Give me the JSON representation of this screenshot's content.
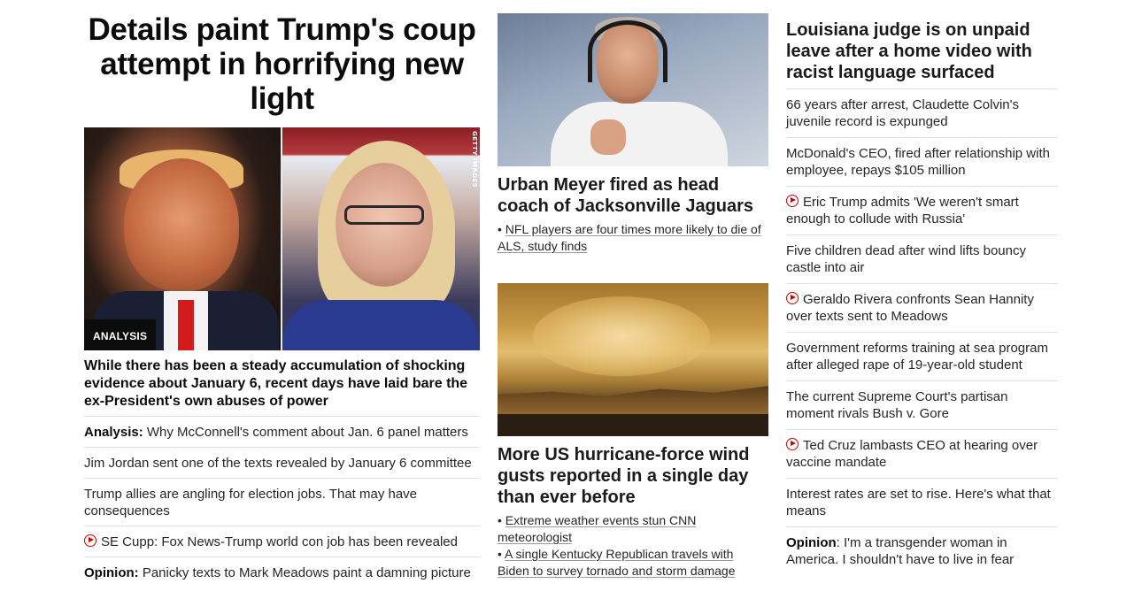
{
  "left": {
    "headline": "Details paint Trump's coup attempt in horrifying new light",
    "image_credit": "GETTY IMAGES",
    "badge": "ANALYSIS",
    "summary": "While there has been a steady accumulation of shocking evidence about January 6, recent days have laid bare the ex-President's own abuses of power",
    "items": [
      {
        "prefix": "Analysis:",
        "text": " Why McConnell's comment about Jan. 6 panel matters"
      },
      {
        "text": "Jim Jordan sent one of the texts revealed by January 6 committee"
      },
      {
        "text": "Trump allies are angling for election jobs. That may have consequences"
      },
      {
        "video": true,
        "icon": "play-icon",
        "text": "SE Cupp: Fox News-Trump world con job has been revealed"
      },
      {
        "prefix": "Opinion:",
        "text": " Panicky texts to Mark Meadows paint a damning picture"
      }
    ]
  },
  "middle": {
    "story1": {
      "headline": "Urban Meyer fired as head coach of Jacksonville Jaguars",
      "related": [
        "NFL players are four times more likely to die of ALS, study finds"
      ]
    },
    "story2": {
      "headline": "More US hurricane-force wind gusts reported in a single day than ever before",
      "related": [
        "Extreme weather events stun CNN meteorologist",
        "A single Kentucky Republican travels with Biden to survey tornado and storm damage"
      ]
    }
  },
  "right": {
    "headline": "Louisiana judge is on unpaid leave after a home video with racist language surfaced",
    "items": [
      {
        "text": "66 years after arrest, Claudette Colvin's juvenile record is expunged"
      },
      {
        "text": "McDonald's CEO, fired after relationship with employee, repays $105 million"
      },
      {
        "video": true,
        "icon": "play-icon",
        "text": "Eric Trump admits 'We weren't smart enough to collude with Russia'"
      },
      {
        "text": "Five children dead after wind lifts bouncy castle into air"
      },
      {
        "video": true,
        "icon": "play-icon",
        "text": "Geraldo Rivera confronts Sean Hannity over texts sent to Meadows"
      },
      {
        "text": "Government reforms training at sea program after alleged rape of 19-year-old student"
      },
      {
        "text": "The current Supreme Court's partisan moment rivals Bush v. Gore"
      },
      {
        "video": true,
        "icon": "play-icon",
        "text": "Ted Cruz lambasts CEO at hearing over vaccine mandate"
      },
      {
        "text": "Interest rates are set to rise. Here's what that means"
      },
      {
        "prefix": "Opinion",
        "text": ": I'm a transgender woman in America. I shouldn't have to live in fear"
      }
    ]
  },
  "colors": {
    "video_icon": "#cc0000",
    "divider": "#e0e0e0",
    "text": "#0c0c0c"
  }
}
